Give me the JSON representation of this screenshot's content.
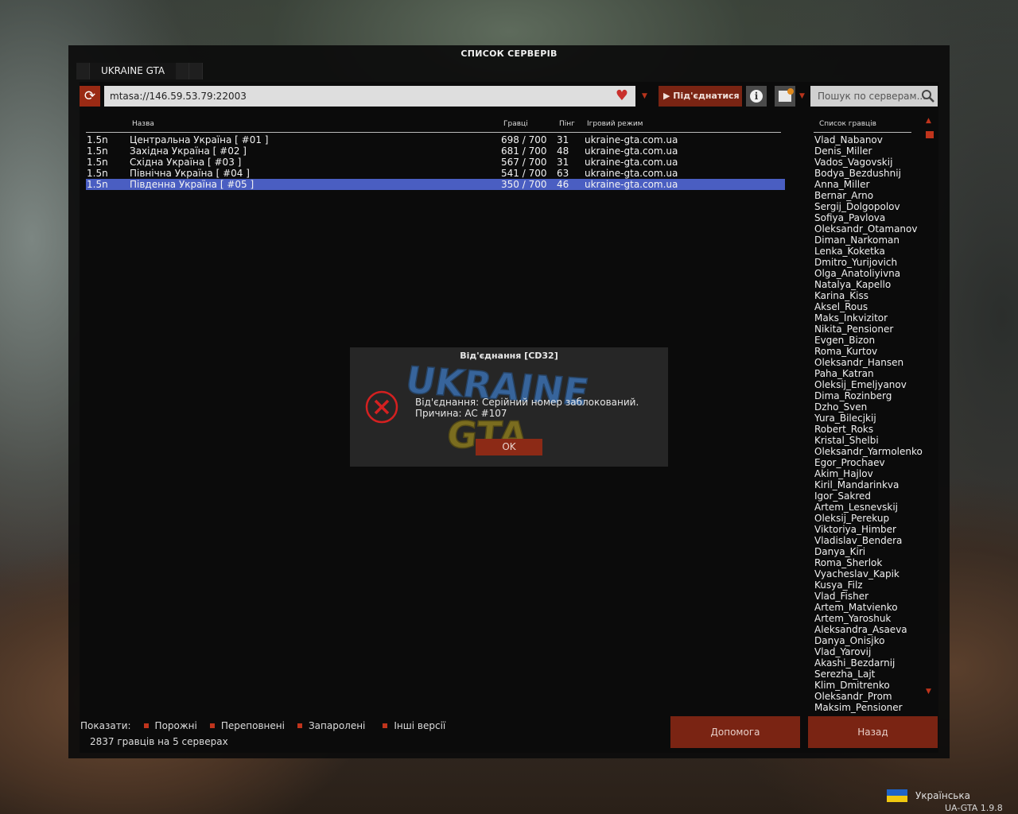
{
  "window": {
    "title": "СПИСОК СЕРВЕРІВ",
    "tab": "UKRAINE GTA"
  },
  "toolbar": {
    "address": "mtasa://146.59.53.79:22003",
    "connect_label": "▶ Під'єднатися",
    "search_placeholder": "Пошук по серверам..."
  },
  "table": {
    "headers": {
      "name": "Назва",
      "players": "Гравці",
      "ping": "Пінг",
      "gamemode": "Ігровий режим"
    },
    "rows": [
      {
        "version": "1.5n",
        "name": "Центральна Україна [ #01 ]",
        "players": "698 / 700",
        "ping": "31",
        "gamemode": "ukraine-gta.com.ua",
        "selected": false
      },
      {
        "version": "1.5n",
        "name": "Західна Україна [ #02 ]",
        "players": "681 / 700",
        "ping": "48",
        "gamemode": "ukraine-gta.com.ua",
        "selected": false
      },
      {
        "version": "1.5n",
        "name": "Східна Україна [ #03 ]",
        "players": "567 / 700",
        "ping": "31",
        "gamemode": "ukraine-gta.com.ua",
        "selected": false
      },
      {
        "version": "1.5n",
        "name": "Північна Україна [ #04 ]",
        "players": "541 / 700",
        "ping": "63",
        "gamemode": "ukraine-gta.com.ua",
        "selected": false
      },
      {
        "version": "1.5n",
        "name": "Південна Україна [ #05 ]",
        "players": "350 / 700",
        "ping": "46",
        "gamemode": "ukraine-gta.com.ua",
        "selected": true
      }
    ]
  },
  "players": {
    "header": "Список гравців",
    "list": [
      "Vlad_Nabanov",
      "Denis_Miller",
      "Vados_Vagovskij",
      "Bodya_Bezdushnij",
      "Anna_Miller",
      "Bernar_Arno",
      "Sergij_Dolgopolov",
      "Sofiya_Pavlova",
      "Oleksandr_Otamanov",
      "Diman_Narkoman",
      "Lenka_Koketka",
      "Dmitro_Yurijovich",
      "Olga_Anatoliyivna",
      "Natalya_Kapello",
      "Karina_Kiss",
      "Aksel_Rous",
      "Maks_Inkvizitor",
      "Nikita_Pensioner",
      "Evgen_Bizon",
      "Roma_Kurtov",
      "Oleksandr_Hansen",
      "Paha_Katran",
      "Oleksij_Emeljyanov",
      "Dima_Rozinberg",
      "Dzho_Sven",
      "Yura_Bilecjkij",
      "Robert_Roks",
      "Kristal_Shelbi",
      "Oleksandr_Yarmolenko",
      "Egor_Prochaev",
      "Akim_Hajlov",
      "Kiril_Mandarinkva",
      "Igor_Sakred",
      "Artem_Lesnevskij",
      "Oleksij_Perekup",
      "Viktoriya_Himber",
      "Vladislav_Bendera",
      "Danya_Kiri",
      "Roma_Sherlok",
      "Vyacheslav_Kapik",
      "Kusya_Filz",
      "Vlad_Fisher",
      "Artem_Matvienko",
      "Artem_Yaroshuk",
      "Aleksandra_Asaeva",
      "Danya_Onisjko",
      "Vlad_Yarovij",
      "Akashi_Bezdarnij",
      "Serezha_Lajt",
      "Klim_Dmitrenko",
      "Oleksandr_Prom",
      "Maksim_Pensioner"
    ]
  },
  "footer": {
    "show_label": "Показати:",
    "filters": [
      "Порожні",
      "Переповнені",
      "Запаролені",
      "Інші версії"
    ],
    "count": "2837 гравців на 5 серверах",
    "help_label": "Допомога",
    "back_label": "Назад"
  },
  "dialog": {
    "title": "Від'єднання [CD32]",
    "message_line1": "Від'єднання: Серійний номер заблокований.",
    "message_line2": "Причина: AC #107",
    "ok_label": "OK",
    "logo_line1": "UKRAINE",
    "logo_line2": "GTA"
  },
  "language": {
    "label": "Українська"
  },
  "version": "UA-GTA 1.9.8"
}
